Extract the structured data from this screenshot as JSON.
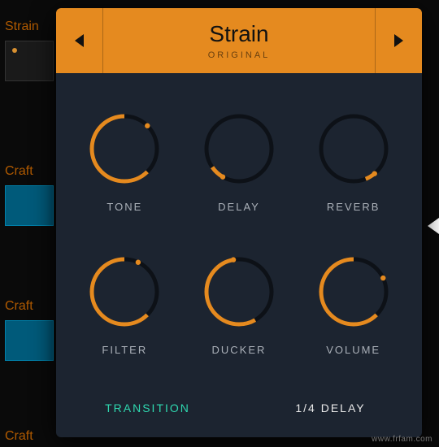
{
  "background": {
    "label_strain": "Strain",
    "label_craft": "Craft"
  },
  "header": {
    "title": "Strain",
    "subtitle": "ORIGINAL"
  },
  "knobs": [
    {
      "label": "TONE",
      "start_deg": 135,
      "sweep_deg": 270,
      "dot_deg": 45
    },
    {
      "label": "DELAY",
      "start_deg": 210,
      "sweep_deg": 25,
      "dot_deg": 210
    },
    {
      "label": "REVERB",
      "start_deg": 140,
      "sweep_deg": 18,
      "dot_deg": 140
    },
    {
      "label": "FILTER",
      "start_deg": 135,
      "sweep_deg": 250,
      "dot_deg": 25
    },
    {
      "label": "DUCKER",
      "start_deg": 150,
      "sweep_deg": 200,
      "dot_deg": 350
    },
    {
      "label": "VOLUME",
      "start_deg": 135,
      "sweep_deg": 290,
      "dot_deg": 65
    }
  ],
  "footer": {
    "left": "TRANSITION",
    "right": "1/4 DELAY"
  },
  "watermark": "www.frfam.com",
  "colors": {
    "accent": "#e58a1f",
    "panel": "#1c2430",
    "transition": "#2fd8b0"
  }
}
